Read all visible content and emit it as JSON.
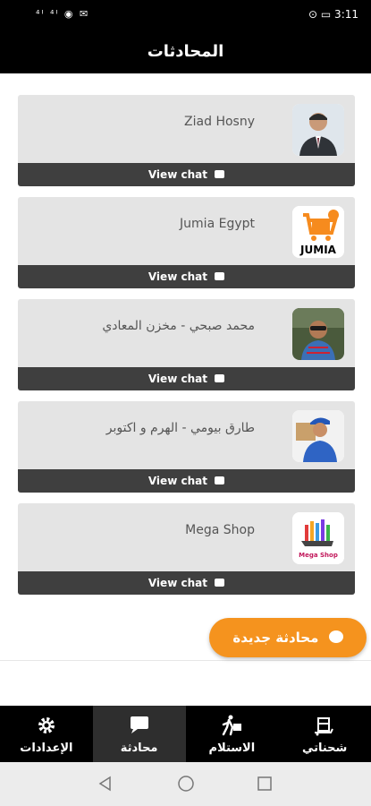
{
  "status_bar": {
    "left_icons": "⁴ᴵ ⁴ᴵ ◉ ✉",
    "right": "⊙ ▭ 3:11"
  },
  "header": {
    "title": "المحادثات"
  },
  "chats": [
    {
      "name": "Ziad Hosny",
      "view_label": "View chat",
      "avatar_icon": "person-photo"
    },
    {
      "name": "Jumia Egypt",
      "view_label": "View chat",
      "avatar_icon": "jumia-logo"
    },
    {
      "name": "محمد صبحي - مخزن المعادي",
      "view_label": "View chat",
      "avatar_icon": "person-photo"
    },
    {
      "name": "طارق بيومي - الهرم و اكتوبر",
      "view_label": "View chat",
      "avatar_icon": "delivery-person"
    },
    {
      "name": "Mega Shop",
      "view_label": "View chat",
      "avatar_icon": "mega-shop-logo"
    }
  ],
  "new_chat_button": {
    "label": "محادثة جديدة"
  },
  "bottom_nav": [
    {
      "label": "شحناتي",
      "icon": "package-icon"
    },
    {
      "label": "الاستلام",
      "icon": "courier-icon"
    },
    {
      "label": "محادثة",
      "icon": "chat-icon",
      "active": true
    },
    {
      "label": "الإعدادات",
      "icon": "gear-icon"
    }
  ],
  "colors": {
    "accent": "#f5931e",
    "bar": "#000000",
    "card": "#e4e4e4",
    "view_bar": "#3f3f3f"
  }
}
